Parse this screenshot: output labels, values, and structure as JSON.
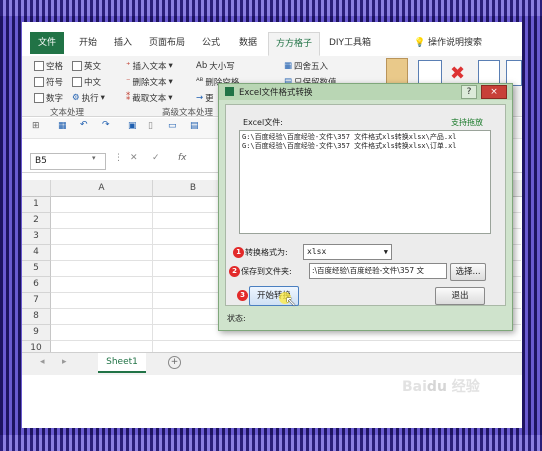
{
  "ribbon_tabs": [
    "文件",
    "开始",
    "插入",
    "页面布局",
    "公式",
    "数据",
    "方方格子",
    "DIY工具箱",
    "操作说明搜索"
  ],
  "ribbon": {
    "checks": [
      "空格",
      "英文",
      "符号",
      "中文",
      "数字"
    ],
    "exec_label": "执行",
    "text_tools": [
      "插入文本",
      "删除文本",
      "截取文本",
      "更"
    ],
    "size_label": "大小写",
    "delete_space": "删除空格",
    "round_label": "四舍五入",
    "only_keep": "只保留数值",
    "group_text": "文本处理",
    "group_adv": "高级文本处理"
  },
  "namebox": "B5",
  "fx_label": "fx",
  "columns": [
    "A",
    "B"
  ],
  "rows": [
    "1",
    "2",
    "3",
    "4",
    "5",
    "6",
    "7",
    "8",
    "9",
    "10"
  ],
  "sheet_tab": "Sheet1",
  "dialog": {
    "title": "Excel文件格式转换",
    "file_label": "Excel文件:",
    "drag_support": "支持拖放",
    "files": [
      "G:\\百度经验\\百度经验-文件\\357 文件格式xls转换xlsx\\产品.xl",
      "G:\\百度经验\\百度经验-文件\\357 文件格式xls转换xlsx\\订单.xl"
    ],
    "format_label": "转换格式为:",
    "format_value": "xlsx",
    "save_label": "保存到文件夹:",
    "save_path": ":\\百度经验\\百度经验-文件\\357 文",
    "choose_button": "选择...",
    "start_button": "开始转换",
    "exit_button": "退出",
    "status_label": "状态:",
    "badges": [
      "1",
      "2",
      "3"
    ],
    "help_glyph": "?",
    "close_glyph": "×"
  },
  "colors": {
    "excel_green": "#217346",
    "badge_red": "#e22a2a",
    "dialog_bg": "#cfe3cc"
  }
}
